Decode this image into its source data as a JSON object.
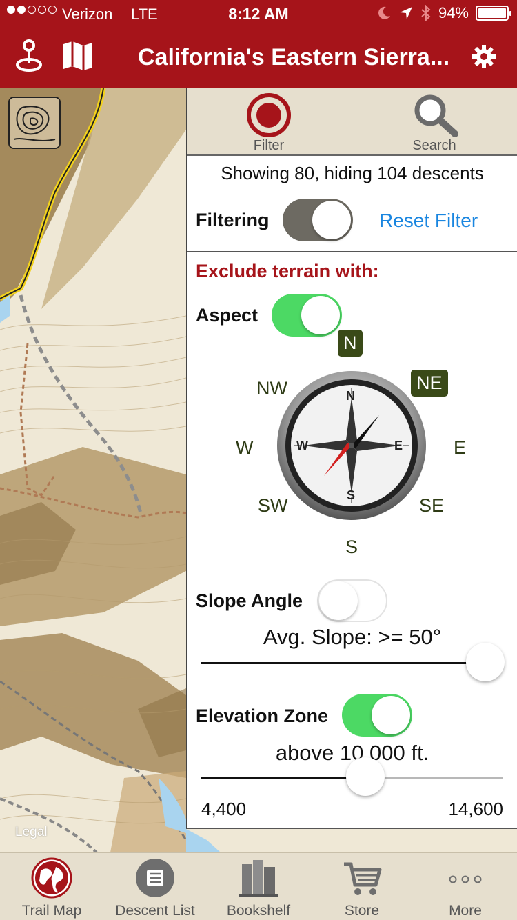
{
  "status_bar": {
    "carrier": "Verizon",
    "network": "LTE",
    "time": "8:12 AM",
    "battery": "94%"
  },
  "nav": {
    "title": "California's Eastern Sierra...",
    "icons": [
      "location-pin-icon",
      "map-icon",
      "gear-icon"
    ]
  },
  "map": {
    "legal_label": "Legal",
    "thumbnail_icon": "topo-map-icon"
  },
  "panel": {
    "tabs": [
      {
        "label": "Filter",
        "icon": "target-icon"
      },
      {
        "label": "Search",
        "icon": "search-icon"
      }
    ],
    "showing_text": "Showing 80, hiding 104 descents",
    "filtering_label": "Filtering",
    "filtering_on": true,
    "reset_filter_label": "Reset Filter",
    "exclude_title": "Exclude terrain with:",
    "aspect": {
      "label": "Aspect",
      "enabled": true,
      "directions": {
        "n": "N",
        "ne": "NE",
        "e": "E",
        "se": "SE",
        "s": "S",
        "sw": "SW",
        "w": "W",
        "nw": "NW"
      },
      "selected": [
        "N",
        "NE"
      ],
      "compass_letters": {
        "n": "N",
        "e": "E",
        "s": "S",
        "w": "W"
      }
    },
    "slope": {
      "label": "Slope Angle",
      "enabled": false,
      "caption": "Avg. Slope: >= 50°",
      "value_fraction": 1.0
    },
    "elevation": {
      "label": "Elevation Zone",
      "enabled": true,
      "caption": "above 10,000 ft.",
      "min_label": "4,400",
      "max_label": "14,600",
      "value_fraction": 0.54
    }
  },
  "tabbar": {
    "items": [
      {
        "label": "Trail Map",
        "icon": "globe-icon",
        "active": true
      },
      {
        "label": "Descent List",
        "icon": "list-icon",
        "active": false
      },
      {
        "label": "Bookshelf",
        "icon": "books-icon",
        "active": false
      },
      {
        "label": "Store",
        "icon": "cart-icon",
        "active": false
      },
      {
        "label": "More",
        "icon": "more-dots-icon",
        "active": false
      }
    ]
  },
  "colors": {
    "brand_red": "#a6141a",
    "toggle_green": "#4cd964",
    "link_blue": "#1a86e0",
    "direction_selected": "#3a4a18",
    "tabbar_bg": "#e6dfce"
  }
}
